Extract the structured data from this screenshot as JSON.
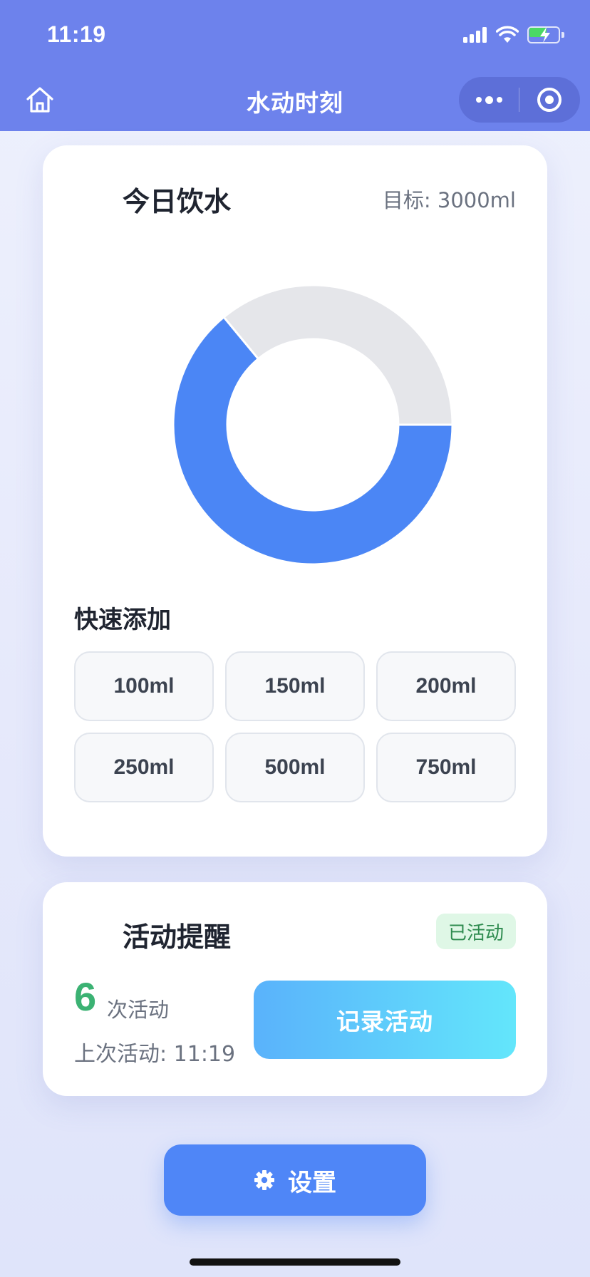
{
  "status_bar": {
    "time": "11:19"
  },
  "nav": {
    "title": "水动时刻"
  },
  "water_card": {
    "title": "今日饮水",
    "goal_text": "目标: 3000ml",
    "quick_add_label": "快速添加",
    "quick_add_options": [
      "100ml",
      "150ml",
      "200ml",
      "250ml",
      "500ml",
      "750ml"
    ]
  },
  "chart_data": {
    "type": "pie",
    "values": [
      0.64,
      0.36
    ],
    "colors": [
      "#4b86f5",
      "#e5e6ea"
    ]
  },
  "activity_card": {
    "title": "活动提醒",
    "status_badge": "已活动",
    "count": "6",
    "count_unit": "次活动",
    "last_activity": "上次活动: 11:19",
    "record_button": "记录活动"
  },
  "settings_button": "设置",
  "colors": {
    "nav_bg": "#6d82ec",
    "primary": "#4f86f7",
    "success": "#3bb273",
    "record_gradient_start": "#5ab2fb",
    "record_gradient_end": "#63e6fb"
  }
}
